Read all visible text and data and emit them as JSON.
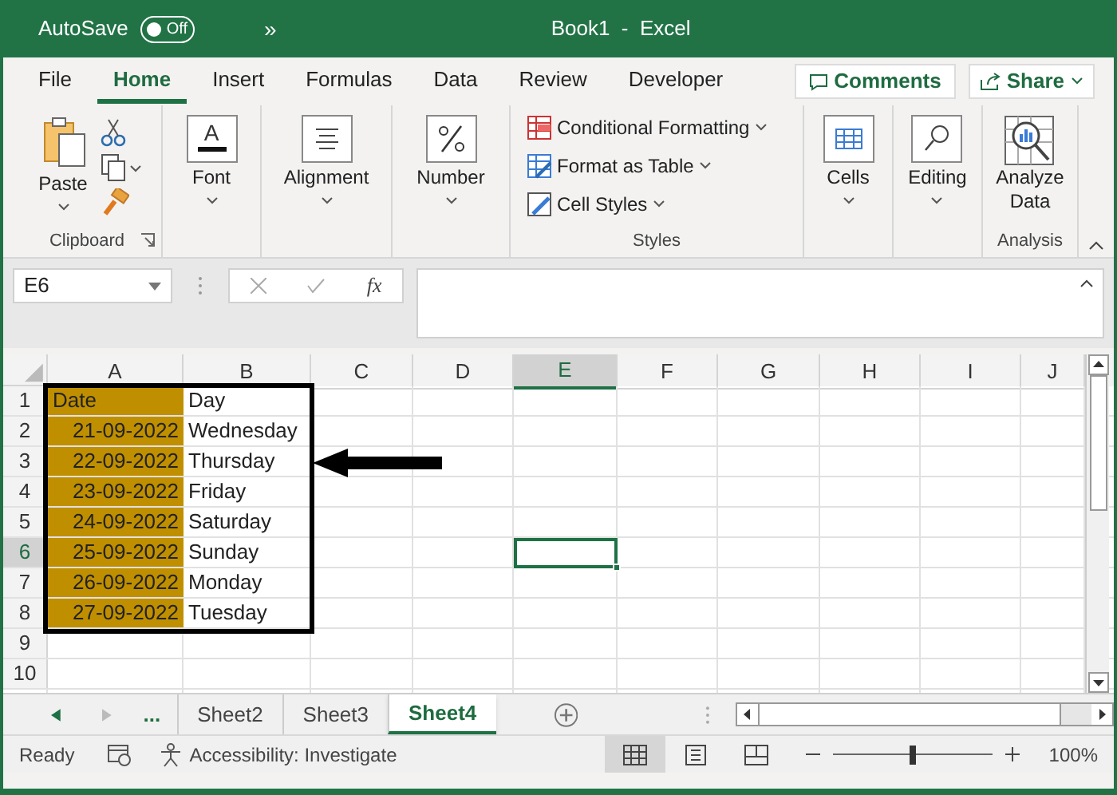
{
  "title_bar": {
    "autosave_label": "AutoSave",
    "autosave_on": false,
    "autosave_state": "Off",
    "more": "»",
    "title": "Book1  -  Excel"
  },
  "menu_tabs": [
    {
      "label": "File",
      "selected": false
    },
    {
      "label": "Home",
      "selected": true
    },
    {
      "label": "Insert",
      "selected": false
    },
    {
      "label": "Formulas",
      "selected": false
    },
    {
      "label": "Data",
      "selected": false
    },
    {
      "label": "Review",
      "selected": false
    },
    {
      "label": "Developer",
      "selected": false
    }
  ],
  "menu_buttons": {
    "comments": "Comments",
    "share": "Share"
  },
  "ribbon": {
    "font_icon": "A",
    "paste": "Paste",
    "clipboard": "Clipboard",
    "font": "Font",
    "alignment": "Alignment",
    "number": "Number",
    "styles_items": [
      "Conditional Formatting",
      "Format as Table",
      "Cell Styles"
    ],
    "styles": "Styles",
    "cells": "Cells",
    "editing": "Editing",
    "analyze": [
      "Analyze",
      "Data"
    ],
    "analysis": "Analysis"
  },
  "formula_bar": {
    "name_box": "E6",
    "fx": "fx"
  },
  "sheet": {
    "columns": [
      {
        "label": "A",
        "selected": false
      },
      {
        "label": "B",
        "selected": false
      },
      {
        "label": "C",
        "selected": false
      },
      {
        "label": "D",
        "selected": false
      },
      {
        "label": "E",
        "selected": true
      },
      {
        "label": "F",
        "selected": false
      },
      {
        "label": "G",
        "selected": false
      },
      {
        "label": "H",
        "selected": false
      },
      {
        "label": "I",
        "selected": false
      },
      {
        "label": "J",
        "selected": false
      }
    ],
    "rows": [
      {
        "number": "1",
        "selected": false,
        "cells": [
          {
            "text": "Date",
            "kind": "text",
            "highlighted": true
          },
          {
            "text": "Day",
            "kind": "text",
            "highlighted": false
          }
        ]
      },
      {
        "number": "2",
        "selected": false,
        "cells": [
          {
            "text": "21-09-2022",
            "kind": "date",
            "highlighted": true
          },
          {
            "text": "Wednesday",
            "kind": "text",
            "highlighted": false
          }
        ]
      },
      {
        "number": "3",
        "selected": false,
        "cells": [
          {
            "text": "22-09-2022",
            "kind": "date",
            "highlighted": true
          },
          {
            "text": "Thursday",
            "kind": "text",
            "highlighted": false
          }
        ]
      },
      {
        "number": "4",
        "selected": false,
        "cells": [
          {
            "text": "23-09-2022",
            "kind": "date",
            "highlighted": true
          },
          {
            "text": "Friday",
            "kind": "text",
            "highlighted": false
          }
        ]
      },
      {
        "number": "5",
        "selected": false,
        "cells": [
          {
            "text": "24-09-2022",
            "kind": "date",
            "highlighted": true
          },
          {
            "text": "Saturday",
            "kind": "text",
            "highlighted": false
          }
        ]
      },
      {
        "number": "6",
        "selected": true,
        "cells": [
          {
            "text": "25-09-2022",
            "kind": "date",
            "highlighted": true
          },
          {
            "text": "Sunday",
            "kind": "text",
            "highlighted": false
          }
        ]
      },
      {
        "number": "7",
        "selected": false,
        "cells": [
          {
            "text": "26-09-2022",
            "kind": "date",
            "highlighted": true
          },
          {
            "text": "Monday",
            "kind": "text",
            "highlighted": false
          }
        ]
      },
      {
        "number": "8",
        "selected": false,
        "cells": [
          {
            "text": "27-09-2022",
            "kind": "date",
            "highlighted": true
          },
          {
            "text": "Tuesday",
            "kind": "text",
            "highlighted": false
          }
        ]
      },
      {
        "number": "9",
        "selected": false,
        "cells": []
      },
      {
        "number": "10",
        "selected": false,
        "cells": []
      }
    ]
  },
  "sheet_tabs": {
    "more": "...",
    "tabs": [
      {
        "label": "Sheet2",
        "selected": false
      },
      {
        "label": "Sheet3",
        "selected": false
      },
      {
        "label": "Sheet4",
        "selected": true
      }
    ]
  },
  "status_bar": {
    "ready": "Ready",
    "accessibility": "Accessibility: Investigate",
    "zoom": "100%",
    "zoom_level": {
      "level": 0.5
    },
    "views": [
      {
        "kind": "normal",
        "selected": true
      },
      {
        "kind": "page-layout",
        "selected": false
      },
      {
        "kind": "page-break",
        "selected": false
      }
    ]
  }
}
